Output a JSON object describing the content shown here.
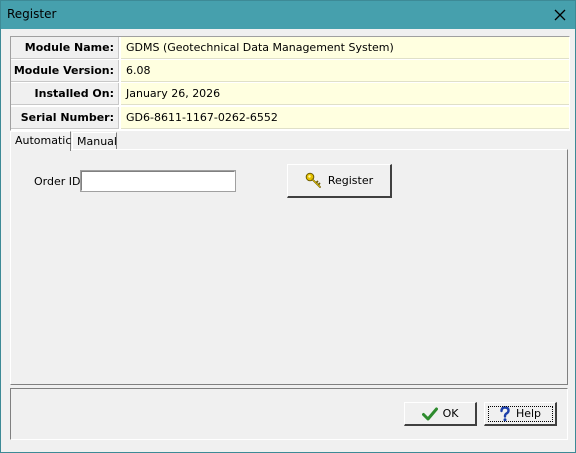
{
  "window": {
    "title": "Register"
  },
  "info": [
    {
      "label": "Module Name:",
      "value": "GDMS (Geotechnical Data Management System)"
    },
    {
      "label": "Module Version:",
      "value": "6.08"
    },
    {
      "label": "Installed On:",
      "value": "January 26, 2026"
    },
    {
      "label": "Serial Number:",
      "value": "GD6-8611-1167-0262-6552"
    }
  ],
  "tabs": [
    {
      "label": "Automatic",
      "active": true
    },
    {
      "label": "Manual",
      "active": false
    }
  ],
  "order": {
    "label": "Order ID:",
    "value": ""
  },
  "buttons": {
    "register": "Register",
    "ok": "OK",
    "help": "Help"
  },
  "icons": {
    "close": "close-icon",
    "register": "key-icon",
    "ok": "checkmark-icon",
    "help": "question-mark-icon"
  },
  "colors": {
    "titlebar": "#46a0ad",
    "info_value_bg": "#ffffe0",
    "ok_check": "#2e8b2e",
    "help_icon": "#1c3faa",
    "key": "#d4b000"
  }
}
